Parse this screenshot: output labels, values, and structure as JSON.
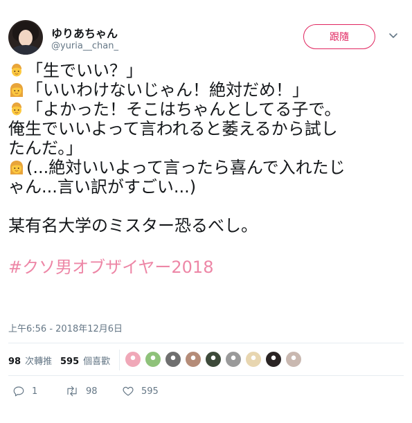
{
  "user": {
    "display_name": "ゆりあちゃん",
    "handle": "@yuria__chan_",
    "follow_label": "跟隨"
  },
  "tweet": {
    "lines": [
      {
        "emoji": "boy",
        "text": "「生でいい？」"
      },
      {
        "emoji": "girl",
        "text": "「いいわけないじゃん！絶対だめ！」"
      },
      {
        "emoji": "boy",
        "text": "「よかった！そこはちゃんとしてる子で。"
      },
      {
        "emoji": null,
        "text": "俺生でいいよって言われると萎えるから試し"
      },
      {
        "emoji": null,
        "text": "たんだ。」"
      },
      {
        "emoji": "girl",
        "text": "(...絶対いいよって言ったら喜んで入れたじ"
      },
      {
        "emoji": null,
        "text": "ゃん...言い訳がすごい...)"
      },
      {
        "emoji": null,
        "text": ""
      },
      {
        "emoji": null,
        "text": "某有名大学のミスター恐るべし。"
      }
    ],
    "hashtag": "#クソ男オブザイヤー2018"
  },
  "timestamp": "上午6:56 - 2018年12月6日",
  "stats": {
    "retweets_count": "98",
    "retweets_label": "次轉推",
    "likes_count": "595",
    "likes_label": "個喜歡"
  },
  "liker_avatars": [
    "#f0a8b8",
    "#8fc27a",
    "#6f6f6f",
    "#b58c78",
    "#3d4a3a",
    "#9a9a9a",
    "#e8d6b0",
    "#2a2424",
    "#c9b8b0"
  ],
  "actions": {
    "reply_count": "1",
    "retweet_count": "98",
    "like_count": "595"
  },
  "colors": {
    "accent": "#e0245e",
    "secondary_text": "#657786",
    "divider": "#e6ecf0"
  }
}
